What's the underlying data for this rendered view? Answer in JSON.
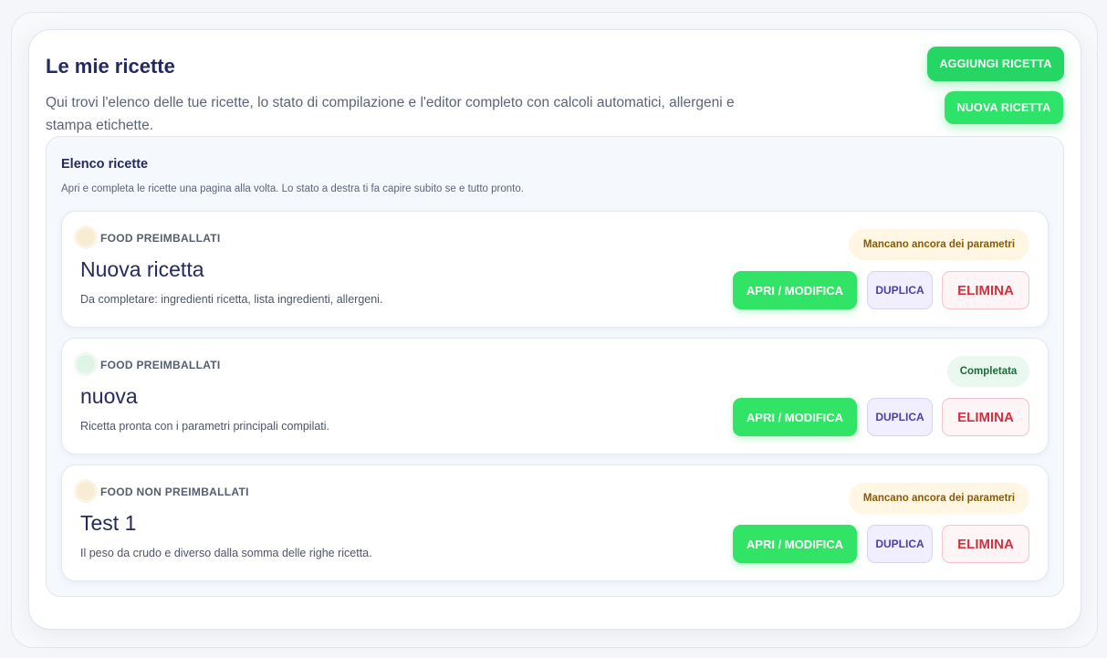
{
  "header": {
    "title": "Le mie ricette",
    "subtitle": "Qui trovi l'elenco delle tue ricette, lo stato di compilazione e l'editor completo con calcoli automatici, allergeni e stampa etichette.",
    "add_button": "AGGIUNGI RICETTA",
    "new_button": "NUOVA RICETTA"
  },
  "list": {
    "title": "Elenco ricette",
    "description": "Apri e completa le ricette una pagina alla volta. Lo stato a destra ti fa capire subito se e tutto pronto.",
    "items": [
      {
        "category": "FOOD PREIMBALLATI",
        "category_dot_color": "#f8ecd2",
        "name": "Nuova ricetta",
        "note": "Da completare: ingredienti ricetta, lista ingredienti, allergeni.",
        "status": "Mancano ancora dei parametri",
        "status_type": "warn",
        "open_label": "APRI / MODIFICA",
        "duplicate_label": "DUPLICA",
        "delete_label": "ELIMINA"
      },
      {
        "category": "FOOD PREIMBALLATI",
        "category_dot_color": "#dff3e6",
        "name": "nuova",
        "note": "Ricetta pronta con i parametri principali compilati.",
        "status": "Completata",
        "status_type": "ok",
        "open_label": "APRI / MODIFICA",
        "duplicate_label": "DUPLICA",
        "delete_label": "ELIMINA"
      },
      {
        "category": "FOOD NON PREIMBALLATI",
        "category_dot_color": "#f8ecd2",
        "name": "Test 1",
        "note": "Il peso da crudo e diverso dalla somma delle righe ricetta.",
        "status": "Mancano ancora dei parametri",
        "status_type": "warn",
        "open_label": "APRI / MODIFICA",
        "duplicate_label": "DUPLICA",
        "delete_label": "ELIMINA"
      }
    ]
  },
  "colors": {
    "accent_green": "#26d665",
    "title_navy": "#252a5e",
    "danger_red": "#d0323f",
    "duplicate_purple": "#4a3fa8"
  }
}
